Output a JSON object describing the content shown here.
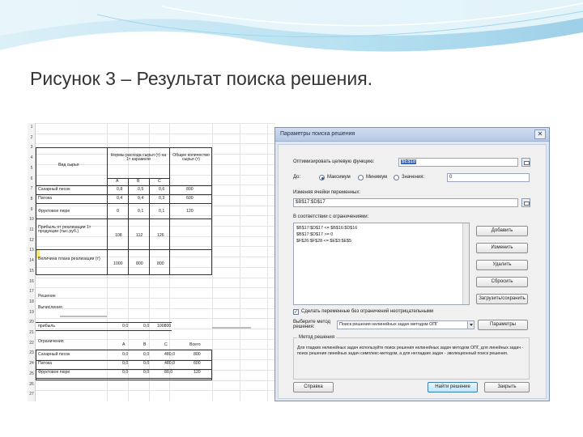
{
  "slide": {
    "title": "Рисунок 3 – Результат поиска решения.",
    "accent_color": "#6ec6e6"
  },
  "spreadsheet": {
    "row_numbers": [
      "1",
      "2",
      "3",
      "4",
      "5",
      "6",
      "7",
      "8",
      "9",
      "10",
      "11",
      "12",
      "13",
      "14",
      "15",
      "16",
      "17",
      "18",
      "19",
      "20",
      "21",
      "22",
      "23",
      "24",
      "25",
      "26",
      "27"
    ],
    "header": {
      "col_a": "Вид сырья",
      "col_b": "Нормы расхода сырья (т) на 1т карамели",
      "col_c": "Общее количество сырья (т)",
      "sub_a": "А",
      "sub_b": "В",
      "sub_c": "С"
    },
    "rows": [
      {
        "name": "Сахарный песок",
        "a": "0,8",
        "b": "0,5",
        "c": "0,6",
        "total": "800"
      },
      {
        "name": "Патока",
        "a": "0,4",
        "b": "0,4",
        "c": "0,3",
        "total": "600"
      },
      {
        "name": "Фруктовое пюре",
        "a": "0",
        "b": "0,1",
        "c": "0,1",
        "total": "120"
      }
    ],
    "profit_row": {
      "label": "Прибыль от реализации 1т продукции (тыс.руб.)",
      "a": "108",
      "b": "112",
      "c": "126"
    },
    "plan_row": {
      "label": "Величина плана реализации (т)",
      "a": "1000",
      "b": "800",
      "c": "800"
    },
    "lower_labels": {
      "r19": "Решение",
      "r20": "Вычисления",
      "r24": "Ограничения",
      "r25_cols": [
        "А",
        "В",
        "С",
        "Всего"
      ]
    },
    "lower_rows": [
      {
        "name": "Сахарный песок",
        "a": "0,0",
        "b": "0,0",
        "c": "480,0",
        "total": "800"
      },
      {
        "name": "Патока",
        "a": "0,0",
        "b": "0,0",
        "c": "480,0",
        "total": "600"
      },
      {
        "name": "Фруктовое пюре",
        "a": "0,0",
        "b": "0,0",
        "c": "80,0",
        "total": "120"
      }
    ],
    "calc_row": {
      "label": "прибыль",
      "a": "0,0",
      "b": "0,0",
      "c": "100800"
    }
  },
  "dialog": {
    "title": "Параметры поиска решения",
    "close_label": "✕",
    "objective_label": "Оптимизировать целевую функцию:",
    "objective_value": "$E$18",
    "to_label": "До:",
    "radio_max": "Максимум",
    "radio_min": "Минимум",
    "radio_value": "Значения:",
    "value_field": "0",
    "changing_label": "Изменяя ячейки переменных:",
    "changing_value": "$B$17:$D$17",
    "constraints_label": "В соответствии с ограничениями:",
    "constraints": [
      "$B$17:$D$17 <= $B$16:$D$16",
      "$B$17:$D$17 >= 0",
      "$F$26:$F$28 <= $E$3:$E$5"
    ],
    "buttons_side": [
      "Добавить",
      "Изменить",
      "Удалить",
      "Сбросить",
      "Загрузить/сохранить"
    ],
    "checkbox_label": "Сделать переменные без ограничений неотрицательными",
    "method_label": "Выберите метод решения:",
    "method_value": "Поиск решения нелинейных задач методом ОПГ",
    "params_button": "Параметры",
    "method_group": "Метод решения",
    "method_desc": "Для гладких нелинейных задач используйте поиск решения нелинейных задач методом ОПГ, для линейных задач - поиск решения линейных задач симплекс-методом, а для негладких задач - эволюционный поиск решения.",
    "help_button": "Справка",
    "solve_button": "Найти решение",
    "close_button": "Закрыть"
  }
}
